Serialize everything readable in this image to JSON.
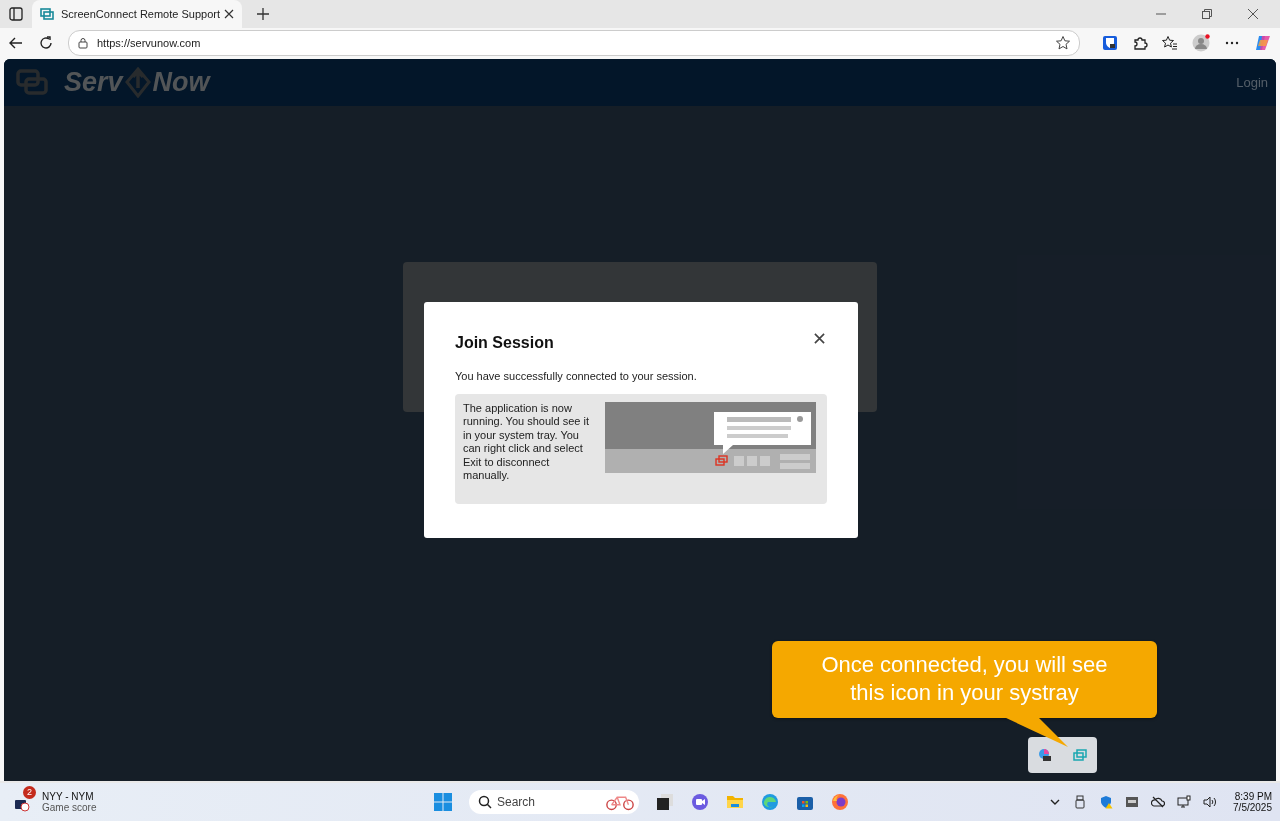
{
  "browser": {
    "tab_title": "ScreenConnect Remote Support",
    "url": "https://servunow.com"
  },
  "header": {
    "logo_words": [
      "Serv",
      "Now"
    ],
    "login": "Login"
  },
  "dialog": {
    "title": "Join Session",
    "message": "You have successfully connected to your session.",
    "info": "The application is now running. You should see it in your system tray. You can right click and select Exit to disconnect manually."
  },
  "callout": {
    "lines": [
      "Once connected, you will see",
      "this icon in your systray"
    ]
  },
  "taskbar": {
    "widget": {
      "badge": "2",
      "title": "NYY - NYM",
      "subtitle": "Game score"
    },
    "search": {
      "placeholder": "Search"
    },
    "clock": {
      "time": "8:39 PM",
      "date": "7/5/2025"
    }
  }
}
